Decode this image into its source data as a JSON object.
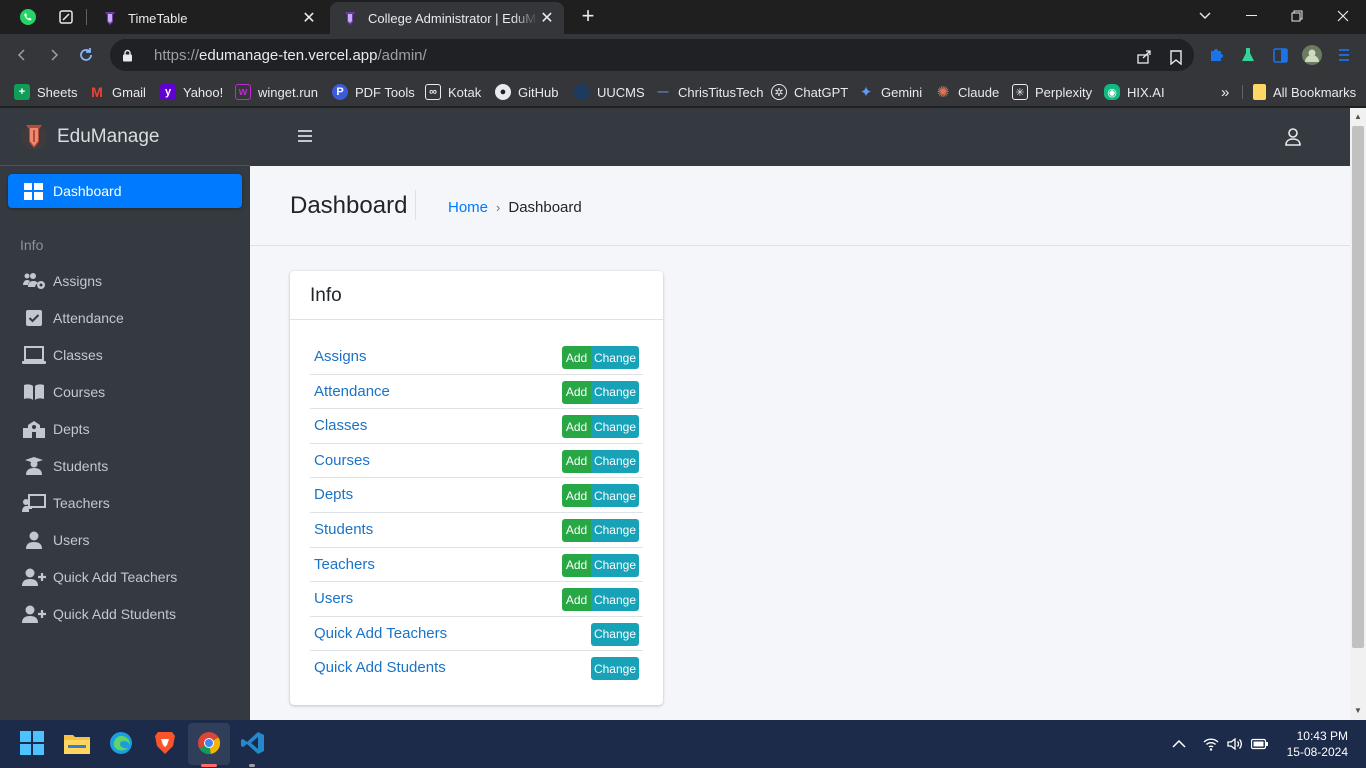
{
  "browser": {
    "tabs": [
      {
        "title": "TimeTable",
        "active": false
      },
      {
        "title": "College Administrator | EduManage",
        "active": true
      }
    ],
    "url_prefix": "https://",
    "url_host": "edumanage-ten.vercel.app",
    "url_path": "/admin/",
    "bookmarks": [
      "Sheets",
      "Gmail",
      "Yahoo!",
      "winget.run",
      "PDF Tools",
      "Kotak",
      "GitHub",
      "UUCMS",
      "ChrisTitusTech",
      "ChatGPT",
      "Gemini",
      "Claude",
      "Perplexity",
      "HIX.AI"
    ],
    "all_bookmarks": "All Bookmarks",
    "overflow": "»"
  },
  "app": {
    "brand": "EduManage",
    "nav_active": "Dashboard",
    "nav_header": "Info",
    "nav_items": [
      {
        "label": "Assigns",
        "icon": "users-cog-icon"
      },
      {
        "label": "Attendance",
        "icon": "check-square-icon"
      },
      {
        "label": "Classes",
        "icon": "laptop-icon"
      },
      {
        "label": "Courses",
        "icon": "book-open-icon"
      },
      {
        "label": "Depts",
        "icon": "school-icon"
      },
      {
        "label": "Students",
        "icon": "user-graduate-icon"
      },
      {
        "label": "Teachers",
        "icon": "chalkboard-teacher-icon"
      },
      {
        "label": "Users",
        "icon": "user-icon"
      },
      {
        "label": "Quick Add Teachers",
        "icon": "user-plus-icon"
      },
      {
        "label": "Quick Add Students",
        "icon": "user-plus-icon"
      }
    ],
    "page_title": "Dashboard",
    "breadcrumb": {
      "home": "Home",
      "separator": "›",
      "current": "Dashboard"
    },
    "card": {
      "title": "Info",
      "add_label": "Add",
      "change_label": "Change",
      "rows": [
        {
          "label": "Assigns",
          "add": true
        },
        {
          "label": "Attendance",
          "add": true
        },
        {
          "label": "Classes",
          "add": true
        },
        {
          "label": "Courses",
          "add": true
        },
        {
          "label": "Depts",
          "add": true
        },
        {
          "label": "Students",
          "add": true
        },
        {
          "label": "Teachers",
          "add": true
        },
        {
          "label": "Users",
          "add": true
        },
        {
          "label": "Quick Add Teachers",
          "add": false
        },
        {
          "label": "Quick Add Students",
          "add": false
        }
      ]
    }
  },
  "taskbar": {
    "time": "10:43 PM",
    "date": "15-08-2024"
  },
  "colors": {
    "primary": "#007bff",
    "add_button": "#28a745",
    "change_button": "#17a2b8",
    "sidebar": "#343a40"
  }
}
